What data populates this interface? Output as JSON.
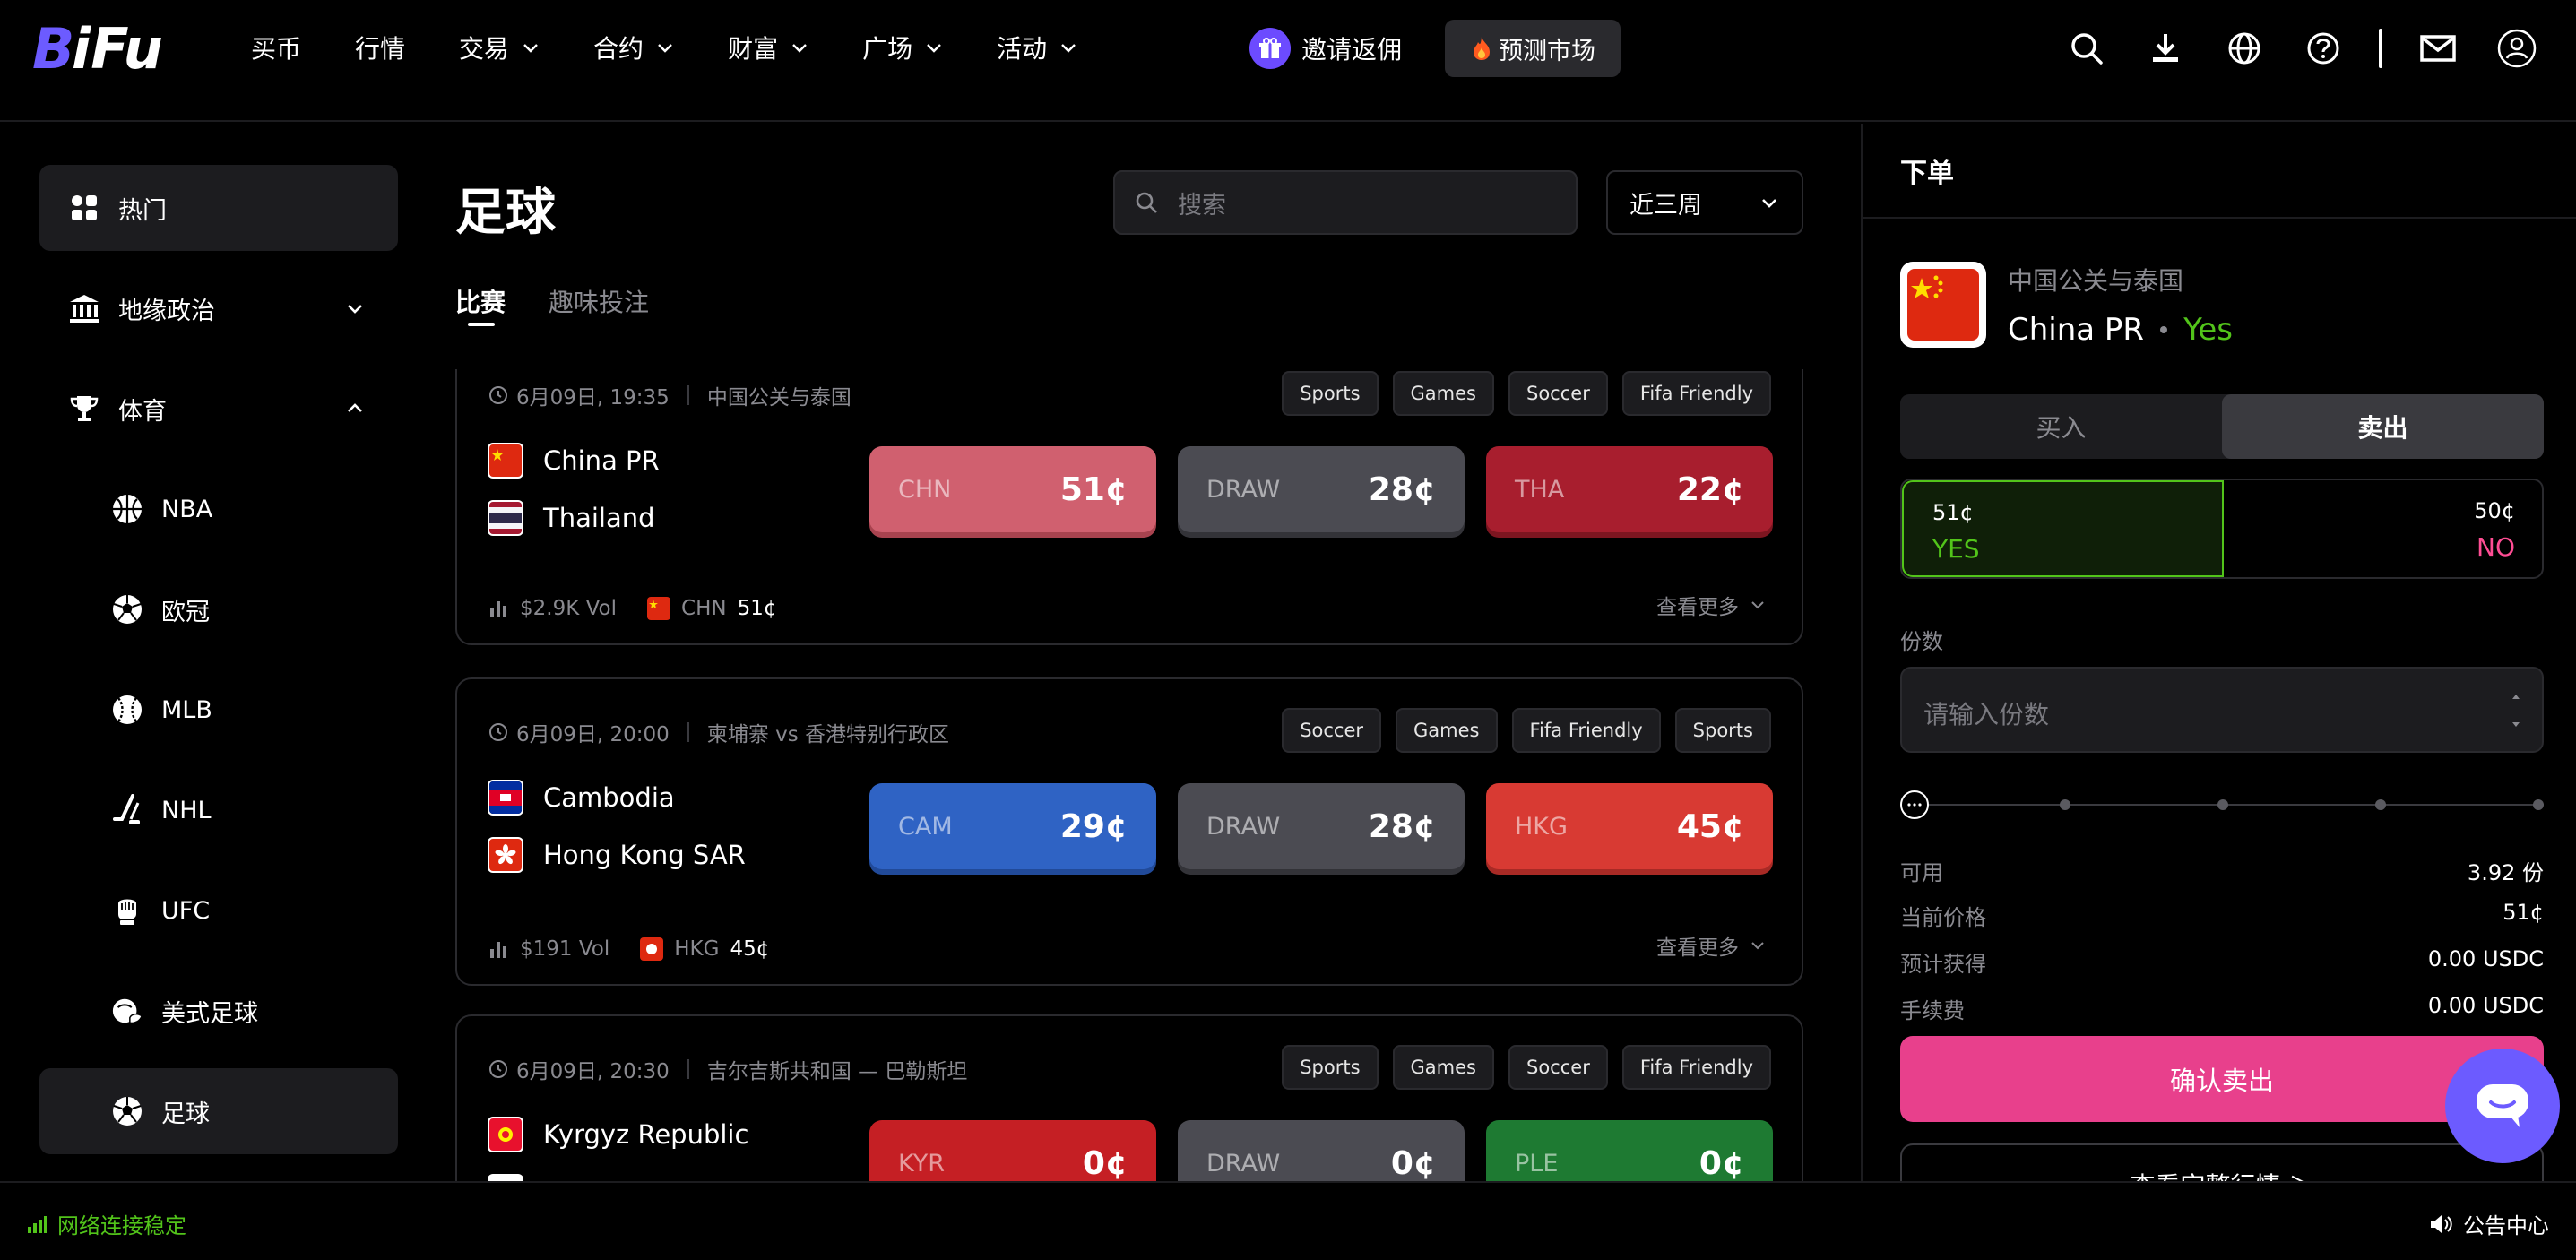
{
  "brand": {
    "logo_text": "BiFu"
  },
  "nav": {
    "items": [
      {
        "label": "买币",
        "dropdown": false
      },
      {
        "label": "行情",
        "dropdown": false
      },
      {
        "label": "交易",
        "dropdown": true
      },
      {
        "label": "合约",
        "dropdown": true
      },
      {
        "label": "财富",
        "dropdown": true
      },
      {
        "label": "广场",
        "dropdown": true
      },
      {
        "label": "活动",
        "dropdown": true
      }
    ],
    "invite_label": "邀请返佣",
    "predict_label": "预测市场",
    "icons": [
      "search-icon",
      "download-icon",
      "globe-icon",
      "help-icon",
      "mail-icon",
      "user-icon"
    ]
  },
  "sidebar": {
    "items": [
      {
        "label": "热门",
        "icon": "grid-icon",
        "active": true
      },
      {
        "label": "地缘政治",
        "icon": "bank-icon",
        "expandable": true
      },
      {
        "label": "体育",
        "icon": "trophy-icon",
        "expandable": true,
        "expanded": true
      },
      {
        "label": "NBA",
        "icon": "basketball-icon",
        "sub": true
      },
      {
        "label": "欧冠",
        "icon": "soccer-ball-icon",
        "sub": true
      },
      {
        "label": "MLB",
        "icon": "baseball-icon",
        "sub": true
      },
      {
        "label": "NHL",
        "icon": "hockey-icon",
        "sub": true
      },
      {
        "label": "UFC",
        "icon": "glove-icon",
        "sub": true
      },
      {
        "label": "美式足球",
        "icon": "football-icon",
        "sub": true
      },
      {
        "label": "足球",
        "icon": "soccer-ball-icon",
        "sub": true,
        "active": true
      }
    ]
  },
  "main": {
    "title": "足球",
    "search_placeholder": "搜索",
    "range_label": "近三周",
    "tabs": [
      {
        "label": "比赛",
        "active": true
      },
      {
        "label": "趣味投注",
        "active": false
      }
    ],
    "events": [
      {
        "time": "6月09日, 19:35",
        "match": "中国公关与泰国",
        "tags": [
          "Sports",
          "Games",
          "Soccer",
          "Fifa Friendly"
        ],
        "teams": [
          {
            "name": "China PR",
            "flag": "cn"
          },
          {
            "name": "Thailand",
            "flag": "th"
          }
        ],
        "odds": [
          {
            "label": "CHN",
            "value": "51¢",
            "color": "#d0606f"
          },
          {
            "label": "DRAW",
            "value": "28¢",
            "color": "#4b4b52"
          },
          {
            "label": "THA",
            "value": "22¢",
            "color": "#a81e2e"
          }
        ],
        "vol": "$2.9K Vol",
        "lead_flag": "cn",
        "lead_code": "CHN",
        "lead_price": "51¢",
        "more": "查看更多"
      },
      {
        "time": "6月09日, 20:00",
        "match": "柬埔寨 vs 香港特别行政区",
        "tags": [
          "Soccer",
          "Games",
          "Fifa Friendly",
          "Sports"
        ],
        "teams": [
          {
            "name": "Cambodia",
            "flag": "kh"
          },
          {
            "name": "Hong Kong SAR",
            "flag": "hk"
          }
        ],
        "odds": [
          {
            "label": "CAM",
            "value": "29¢",
            "color": "#2f63c4"
          },
          {
            "label": "DRAW",
            "value": "28¢",
            "color": "#4b4b52"
          },
          {
            "label": "HKG",
            "value": "45¢",
            "color": "#d83a33"
          }
        ],
        "vol": "$191 Vol",
        "lead_flag": "hk",
        "lead_code": "HKG",
        "lead_price": "45¢",
        "more": "查看更多"
      },
      {
        "time": "6月09日, 20:30",
        "match": "吉尔吉斯共和国 — 巴勒斯坦",
        "tags": [
          "Sports",
          "Games",
          "Soccer",
          "Fifa Friendly"
        ],
        "teams": [
          {
            "name": "Kyrgyz Republic",
            "flag": "kg"
          },
          {
            "name": "",
            "flag": "ps"
          }
        ],
        "odds": [
          {
            "label": "KYR",
            "value": "0¢",
            "color": "#c51f24"
          },
          {
            "label": "DRAW",
            "value": "0¢",
            "color": "#4b4b52"
          },
          {
            "label": "PLE",
            "value": "0¢",
            "color": "#1e7a32"
          }
        ],
        "vol": "",
        "lead_flag": "",
        "lead_code": "",
        "lead_price": "",
        "more": ""
      }
    ]
  },
  "order": {
    "title": "下单",
    "market": "中国公关与泰国",
    "team": "China PR",
    "side": "Yes",
    "buy_label": "买入",
    "sell_label": "卖出",
    "yes_price": "51¢",
    "yes_label": "YES",
    "no_price": "50¢",
    "no_label": "NO",
    "qty_label": "份数",
    "qty_placeholder": "请输入份数",
    "available_k": "可用",
    "available_v": "3.92 份",
    "price_k": "当前价格",
    "price_v": "51¢",
    "est_k": "预计获得",
    "est_v": "0.00 USDC",
    "fee_k": "手续费",
    "fee_v": "0.00 USDC",
    "confirm_label": "确认卖出",
    "full_market_label": "查看完整行情 ＞"
  },
  "footer": {
    "network": "网络连接稳定",
    "announcement": "公告中心"
  },
  "colors": {
    "accent_green": "#52c41a",
    "accent_pink": "#e8408c",
    "yes_green": "#52c41a",
    "no_pink": "#ff4d94"
  }
}
